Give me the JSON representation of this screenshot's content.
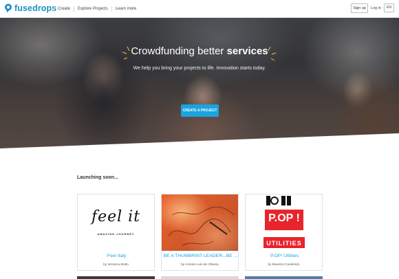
{
  "header": {
    "logo_text": "fusedrops",
    "nav": [
      "Create",
      "Explore Projects",
      "Learn more"
    ],
    "signup": "Sign up",
    "login": "Log in",
    "lang": "EN"
  },
  "hero": {
    "title_prefix": "Crowdfunding better ",
    "title_bold": "services",
    "subtitle": "We help you bring your projects to life. Innovation starts today.",
    "cta": "CREATE A PROJECT"
  },
  "section": {
    "title": "Launching soon..."
  },
  "cards": [
    {
      "title": "Feel Italy",
      "author": "by Veronica Mutto",
      "thumb_text": "feel it",
      "thumb_sub": "AMAZING JOURNEY"
    },
    {
      "title": "BE A THUMBRINT LEADER...BE ...",
      "author": "by Antonio Luis de Oliveira"
    },
    {
      "title": "P.OP! Utilities",
      "author": "by Maurizio Candeloro",
      "thumb_text": "P.OP !",
      "thumb_sub": "UTILITIES"
    }
  ],
  "colors": {
    "brand": "#1b8fc4",
    "accent": "#1aa3e0"
  }
}
